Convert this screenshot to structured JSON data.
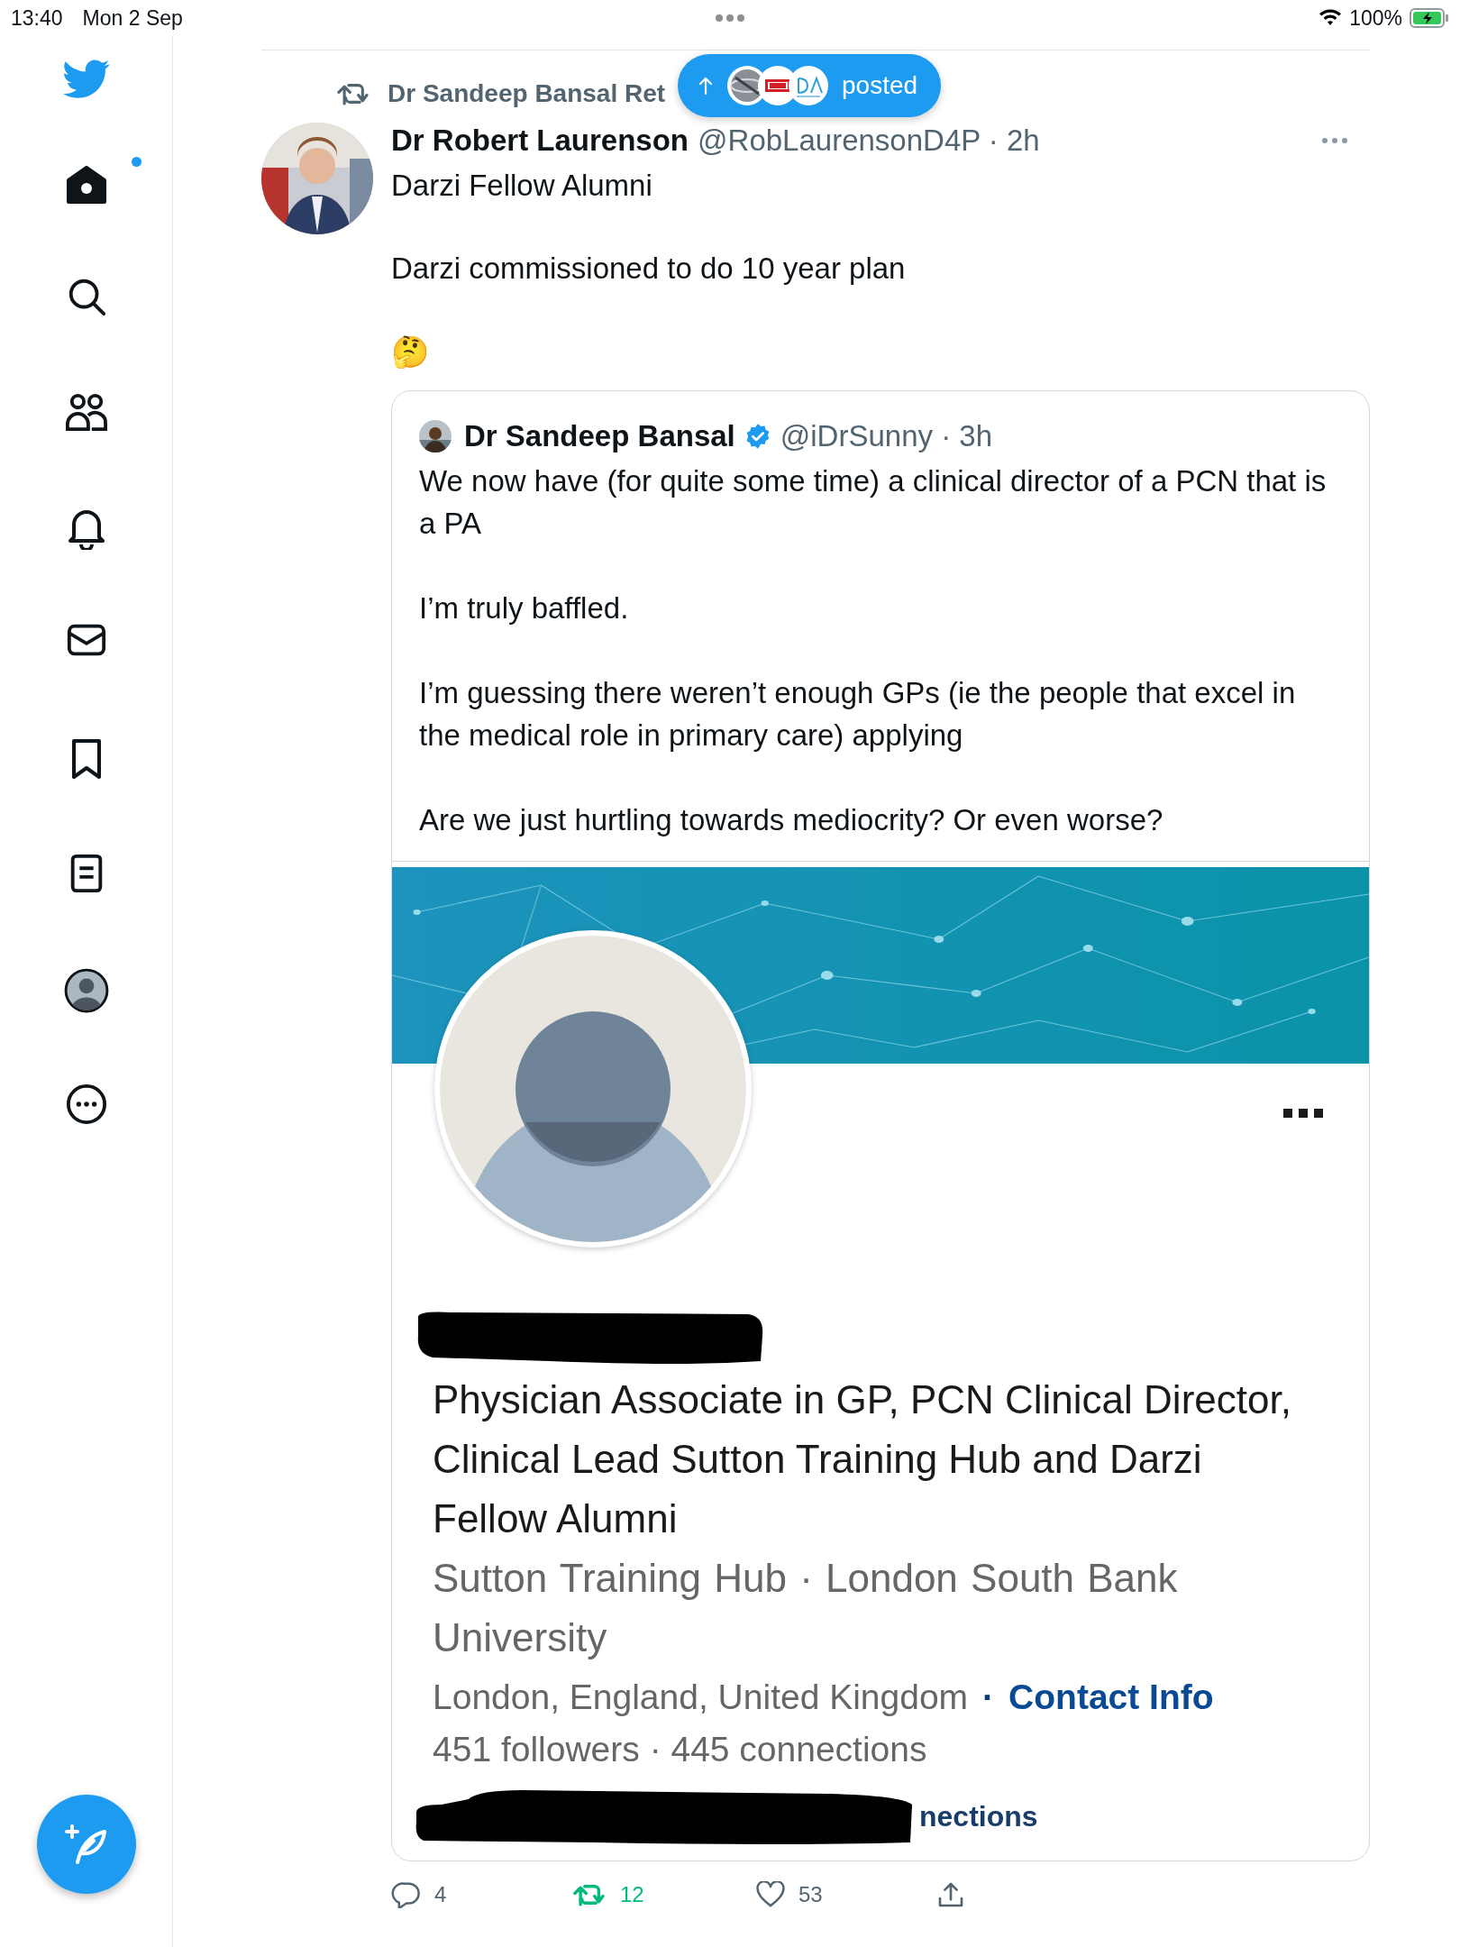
{
  "status_bar": {
    "time": "13:40",
    "date": "Mon 2 Sep",
    "battery": "100%"
  },
  "sidebar": {
    "items": [
      {
        "kind": "logo",
        "selected": false,
        "unread": false
      },
      {
        "kind": "home",
        "selected": true,
        "unread": true
      },
      {
        "kind": "search",
        "selected": false,
        "unread": false
      },
      {
        "kind": "communities",
        "selected": false,
        "unread": false
      },
      {
        "kind": "notifications",
        "selected": false,
        "unread": false
      },
      {
        "kind": "messages",
        "selected": false,
        "unread": false
      },
      {
        "kind": "bookmarks",
        "selected": false,
        "unread": false
      },
      {
        "kind": "lists",
        "selected": false,
        "unread": false
      },
      {
        "kind": "profile",
        "selected": false,
        "unread": false
      },
      {
        "kind": "more",
        "selected": false,
        "unread": false
      }
    ]
  },
  "retweet_banner": {
    "text": "Dr Sandeep Bansal Ret"
  },
  "new_posts_pill": {
    "label": "posted"
  },
  "tweet": {
    "author": "Dr Robert Laurenson",
    "meta": "@RobLaurensonD4P · 2h",
    "paragraphs": [
      "Darzi Fellow Alumni",
      "Darzi commissioned to do 10 year plan"
    ],
    "emoji": "🤔",
    "quote": {
      "author": "Dr Sandeep Bansal",
      "verified": true,
      "meta": "@iDrSunny · 3h",
      "paragraphs": [
        "We now have (for quite some time) a clinical director of a PCN that is a PA",
        "I’m truly baffled.",
        "I’m guessing there weren’t enough GPs (ie the people that excel in the medical role in primary care) applying",
        "Are we just hurtling towards mediocrity? Or even worse?"
      ],
      "profile_card": {
        "headline": "Physician Associate in GP, PCN Clinical Director, Clinical Lead Sutton Training Hub and Darzi Fellow Alumni",
        "orgs": "Sutton Training Hub  ·  London South Bank University",
        "location_line": [
          {
            "kind": "text",
            "text": "London, England, United Kingdom"
          },
          {
            "kind": "separator",
            "text": "·"
          },
          {
            "kind": "link",
            "text": "Contact Info"
          }
        ],
        "stats": "451 followers  ·  445 connections",
        "fragment": "nections"
      }
    },
    "actions": [
      {
        "kind": "reply",
        "count": "4",
        "active": false
      },
      {
        "kind": "retweet",
        "count": "12",
        "active": true
      },
      {
        "kind": "like",
        "count": "53",
        "active": false
      },
      {
        "kind": "share",
        "active": false
      }
    ]
  }
}
